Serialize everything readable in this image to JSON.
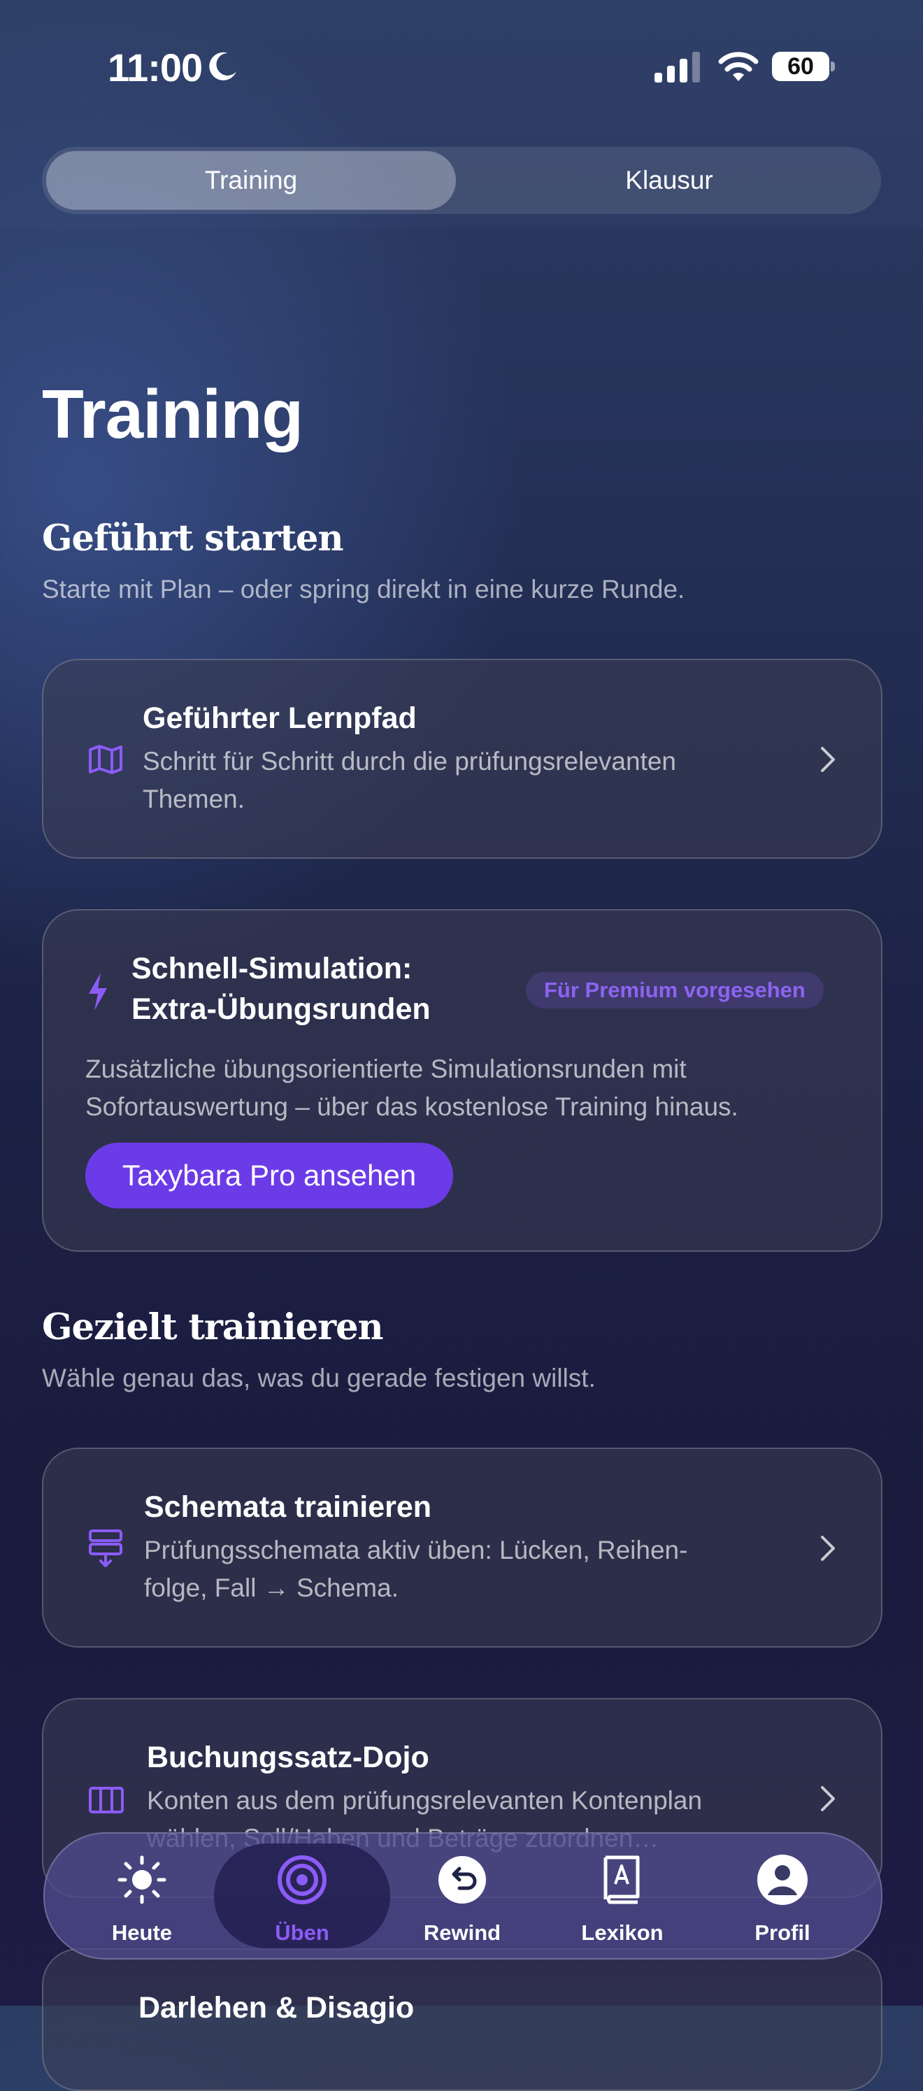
{
  "status_bar": {
    "time": "11:00",
    "battery": "60"
  },
  "segment": {
    "options": [
      "Training",
      "Klausur"
    ],
    "selected": "Training"
  },
  "page_title": "Training",
  "section1": {
    "title": "Geführt starten",
    "subtitle": "Starte mit Plan – oder spring direkt in eine kurze Runde."
  },
  "card_lernpfad": {
    "icon": "map-icon",
    "title": "Geführter Lernpfad",
    "desc_line1": "Schritt für Schritt durch die prüfungsrelevanten",
    "desc_line2": "Themen."
  },
  "card_simulation": {
    "icon": "lightning-icon",
    "title_line1": "Schnell-Simulation:",
    "title_line2": "Extra-Übungsrunden",
    "badge": "Für Premium vorgesehen",
    "desc_line1": "Zusätzliche übungsorientierte Simulationsrunden mit",
    "desc_line2": "Sofortauswertung – über das kostenlose Training hinaus.",
    "button": "Taxybara Pro ansehen"
  },
  "section2": {
    "title": "Gezielt trainieren",
    "subtitle": "Wähle genau das, was du gerade festigen willst."
  },
  "card_schemata": {
    "icon": "schema-icon",
    "title": "Schemata trainieren",
    "desc_line1": "Prüfungsschemata aktiv üben: Lücken, Reihen-",
    "desc_line2": "folge, Fall → Schema."
  },
  "card_dojo": {
    "icon": "columns-icon",
    "title": "Buchungssatz-Dojo",
    "desc_line1": "Konten aus dem prüfungsrelevanten Kontenplan",
    "desc_line2": "wählen, Soll/Haben und Beträge zuordnen…"
  },
  "card_next": {
    "title": "Darlehen & Disagio"
  },
  "tabbar": {
    "selected": "Üben",
    "accent": "#8b5cf6",
    "items": [
      {
        "label": "Heute",
        "icon": "sun-icon"
      },
      {
        "label": "Üben",
        "icon": "target-icon"
      },
      {
        "label": "Rewind",
        "icon": "rewind-icon"
      },
      {
        "label": "Lexikon",
        "icon": "dictionary-icon"
      },
      {
        "label": "Profil",
        "icon": "profile-icon"
      }
    ]
  }
}
